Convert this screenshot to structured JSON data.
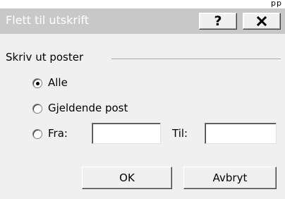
{
  "window": {
    "title": "Flett til utskrift",
    "help_label": "?",
    "corner_glyph": "pp"
  },
  "group": {
    "label": "Skriv ut poster"
  },
  "radios": [
    {
      "label": "Alle",
      "checked": true
    },
    {
      "label": "Gjeldende post",
      "checked": false
    },
    {
      "label": "Fra:",
      "checked": false
    }
  ],
  "to_label": "Til:",
  "from_value": "",
  "to_value": "",
  "buttons": {
    "ok": "OK",
    "cancel": "Avbryt"
  }
}
